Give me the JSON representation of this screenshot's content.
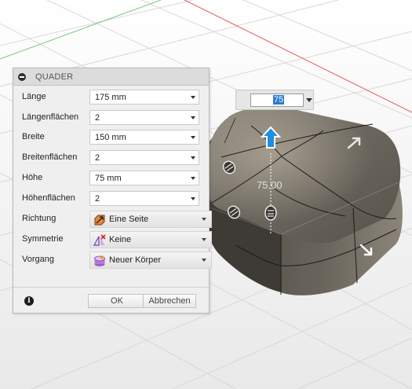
{
  "viewport": {
    "dimension_label": "75.00",
    "dimension_input": {
      "value": "75"
    }
  },
  "dialog": {
    "title": "QUADER",
    "fields": [
      {
        "label": "Länge",
        "value": "175 mm"
      },
      {
        "label": "Längenflächen",
        "value": "2"
      },
      {
        "label": "Breite",
        "value": "150 mm"
      },
      {
        "label": "Breitenflächen",
        "value": "2"
      },
      {
        "label": "Höhe",
        "value": "75 mm"
      },
      {
        "label": "Höhenflächen",
        "value": "2"
      }
    ],
    "selects": [
      {
        "label": "Richtung",
        "value": "Eine Seite",
        "icon": "direction-one-side-icon"
      },
      {
        "label": "Symmetrie",
        "value": "Keine",
        "icon": "symmetry-none-icon"
      },
      {
        "label": "Vorgang",
        "value": "Neuer Körper",
        "icon": "new-body-icon"
      }
    ],
    "ok_label": "OK",
    "cancel_label": "Abbrechen",
    "info_icon": "i"
  },
  "colors": {
    "accent_blue": "#1e8fe0",
    "body_dark": "#4a463f",
    "body_light": "#8a8478",
    "grid_red": "#e85a5a",
    "grid_green": "#7cc97c"
  }
}
